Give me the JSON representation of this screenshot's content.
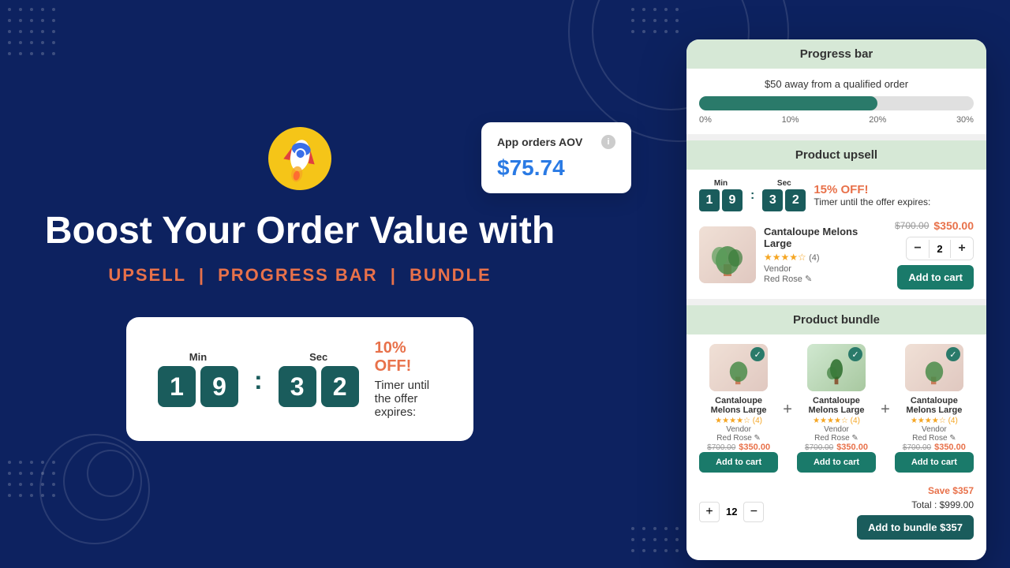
{
  "background": {
    "color": "#0d2260"
  },
  "left": {
    "title": "Boost Your Order Value with",
    "subtitle_parts": [
      "UPSELL",
      "|",
      "PROGRESS BAR",
      "|",
      "BUNDLE"
    ]
  },
  "aov_card": {
    "title": "App orders AOV",
    "info": "i",
    "value": "$75.74"
  },
  "left_timer": {
    "min_label": "Min",
    "sec_label": "Sec",
    "digits": [
      "1",
      "9",
      "3",
      "2"
    ],
    "discount": "10% OFF!",
    "description": "Timer until the offer expires:"
  },
  "right_panel": {
    "progress_bar": {
      "section_label": "Progress bar",
      "progress_text": "$50 away from a qualified order",
      "fill_percent": 65,
      "labels": [
        "0%",
        "10%",
        "20%",
        "30%"
      ]
    },
    "product_upsell": {
      "section_label": "Product upsell",
      "timer": {
        "min_label": "Min",
        "sec_label": "Sec",
        "digits": [
          "1",
          "9",
          "3",
          "2"
        ],
        "discount": "15% OFF!",
        "description": "Timer until the offer expires:"
      },
      "product": {
        "name": "Cantaloupe Melons Large",
        "stars": 4,
        "star_count": "(4)",
        "vendor_label": "Vendor",
        "vendor_name": "Red Rose",
        "price_original": "$700.00",
        "price_sale": "$350.00",
        "quantity": "2",
        "add_to_cart": "Add to cart"
      }
    },
    "product_bundle": {
      "section_label": "Product bundle",
      "items": [
        {
          "name": "Cantaloupe Melons Large",
          "stars": 4,
          "star_count": "(4)",
          "vendor_label": "Vendor",
          "vendor_name": "Red Rose",
          "price_original": "$700.00",
          "price_sale": "$350.00",
          "add_to_cart": "Add to cart"
        },
        {
          "name": "Cantaloupe Melons Large",
          "stars": 4,
          "star_count": "(4)",
          "vendor_label": "Vendor",
          "vendor_name": "Red Rose",
          "price_original": "$700.00",
          "price_sale": "$350.00",
          "add_to_cart": "Add to cart"
        },
        {
          "name": "Cantaloupe Melons Large",
          "stars": 4,
          "star_count": "(4)",
          "vendor_label": "Vendor",
          "vendor_name": "Red Rose",
          "price_original": "$700.00",
          "price_sale": "$350.00",
          "add_to_cart": "Add to cart"
        }
      ],
      "qty_value": "12",
      "save_text": "Save $357",
      "total_text": "Total : $999.00",
      "add_bundle_btn": "Add to bundle $357"
    }
  }
}
